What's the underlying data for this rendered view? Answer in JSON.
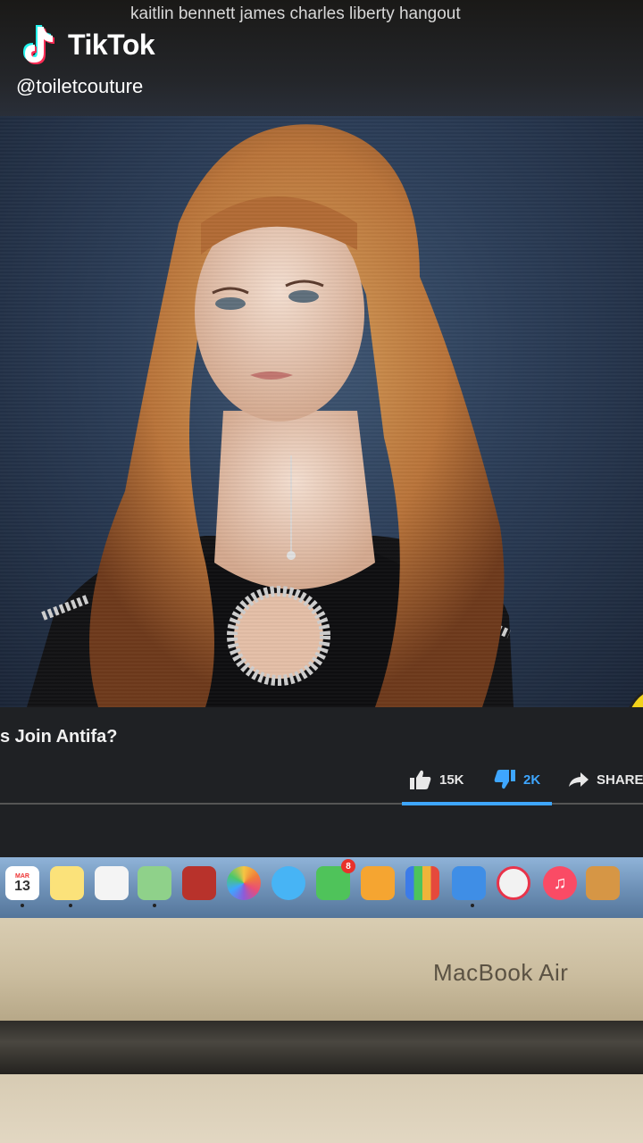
{
  "overlay": {
    "caption": "kaitlin bennett james charles liberty hangout",
    "brand": "TikTok",
    "handle": "@toiletcouture"
  },
  "youtube": {
    "title": "s Join Antifa?",
    "likes": "15K",
    "dislikes": "2K",
    "share_label": "SHARE",
    "accent_color": "#3ea6ff"
  },
  "dock": {
    "calendar_month": "MAR",
    "calendar_day": "13",
    "items": [
      "calendar-icon",
      "notes-icon",
      "reminders-icon",
      "maps-icon",
      "photo-booth-icon",
      "photos-icon",
      "messages-icon",
      "facetime-icon",
      "pages-icon",
      "numbers-icon",
      "keynote-icon",
      "news-icon",
      "music-icon",
      "garageband-icon"
    ],
    "facetime_badge": "8"
  },
  "laptop": {
    "model_label": "MacBook Air"
  }
}
